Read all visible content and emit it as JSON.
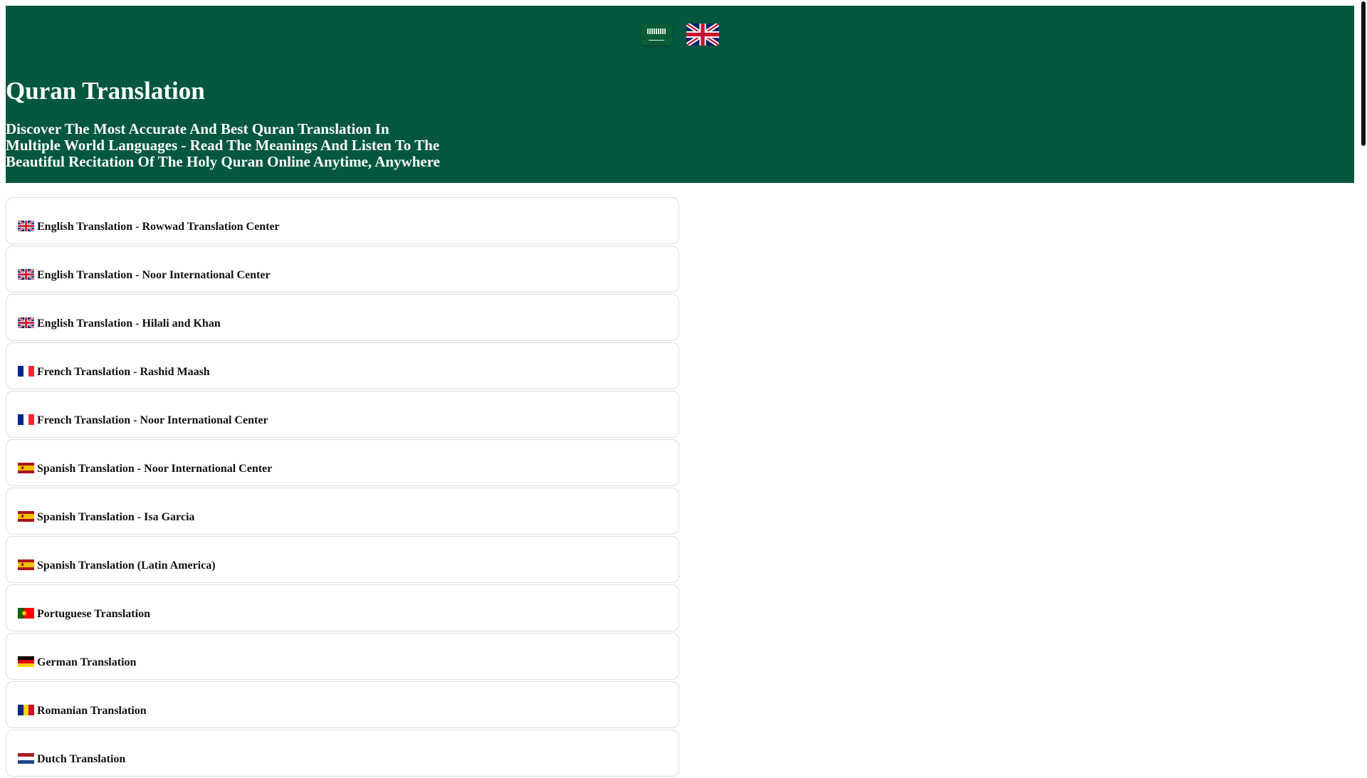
{
  "header": {
    "title": "Quran Translation",
    "subtitle": "Discover The Most Accurate And Best Quran Translation In Multiple World Languages - Read The Meanings And Listen To The Beautiful Recitation Of The Holy Quran Online Anytime, Anywhere",
    "languages": [
      "arabic-flag-icon",
      "uk-flag-icon"
    ],
    "color": "#03573f"
  },
  "translations": [
    {
      "label": "English Translation - Rowwad Translation Center",
      "flag": "uk"
    },
    {
      "label": "English Translation - Noor International Center",
      "flag": "uk"
    },
    {
      "label": "English Translation - Hilali and Khan",
      "flag": "uk"
    },
    {
      "label": "French Translation - Rashid Maash",
      "flag": "fr"
    },
    {
      "label": "French Translation - Noor International Center",
      "flag": "fr"
    },
    {
      "label": "Spanish Translation - Noor International Center",
      "flag": "es"
    },
    {
      "label": "Spanish Translation - Isa Garcia",
      "flag": "es"
    },
    {
      "label": "Spanish Translation (Latin America)",
      "flag": "es"
    },
    {
      "label": "Portuguese Translation",
      "flag": "pt"
    },
    {
      "label": "German Translation",
      "flag": "de"
    },
    {
      "label": "Romanian Translation",
      "flag": "ro"
    },
    {
      "label": "Dutch Translation",
      "flag": "nl"
    }
  ]
}
